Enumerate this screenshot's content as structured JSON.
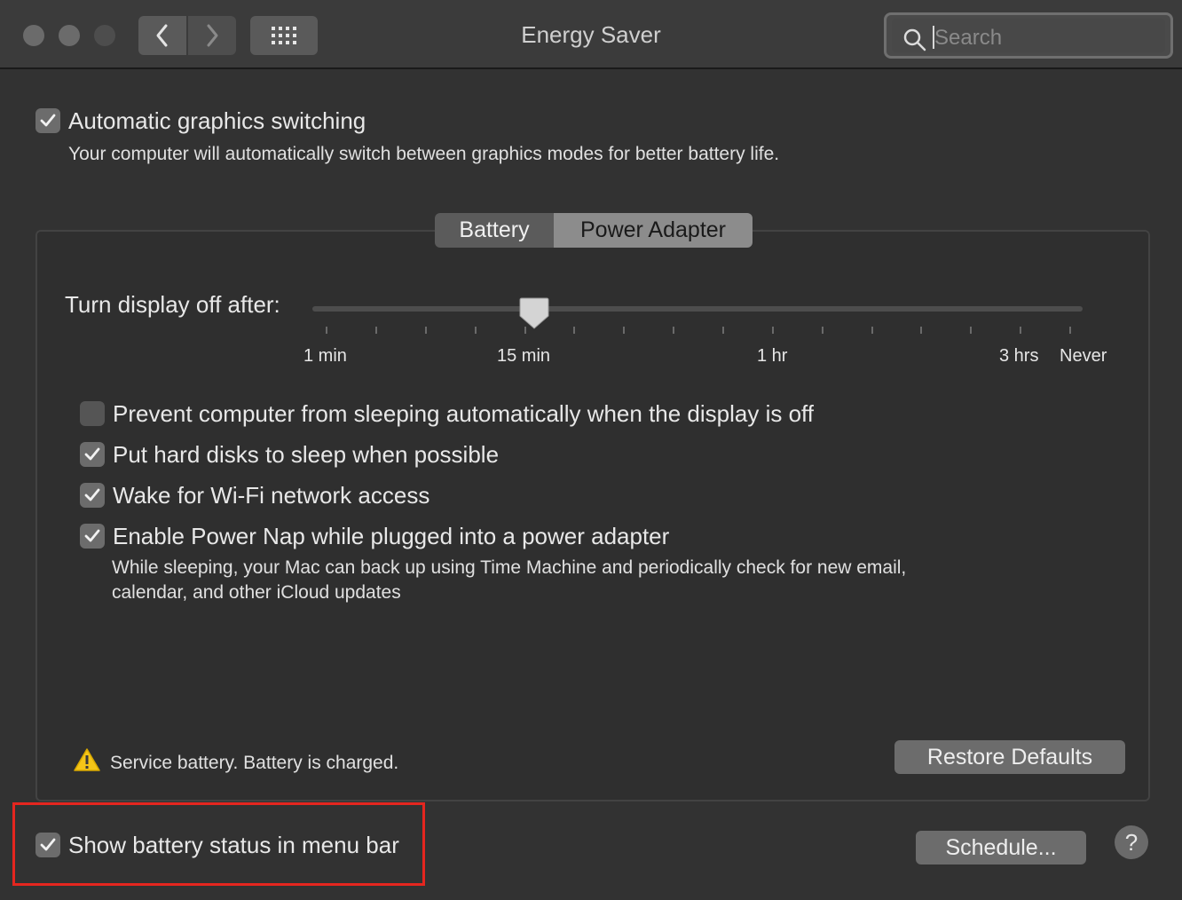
{
  "window": {
    "title": "Energy Saver"
  },
  "toolbar": {
    "back_icon": "chevron-left-icon",
    "forward_icon": "chevron-right-icon",
    "grid_icon": "grid-icon",
    "search_placeholder": "Search"
  },
  "graphics": {
    "checked": true,
    "label": "Automatic graphics switching",
    "description": "Your computer will automatically switch between graphics modes for better battery life."
  },
  "tabs": [
    {
      "label": "Battery",
      "selected": false
    },
    {
      "label": "Power Adapter",
      "selected": true
    }
  ],
  "display_off": {
    "label": "Turn display off after:",
    "tick_labels": [
      "1 min",
      "15 min",
      "1 hr",
      "3 hrs",
      "Never"
    ],
    "selected_value": "15 min"
  },
  "options": [
    {
      "checked": false,
      "label": "Prevent computer from sleeping automatically when the display is off"
    },
    {
      "checked": true,
      "label": "Put hard disks to sleep when possible"
    },
    {
      "checked": true,
      "label": "Wake for Wi-Fi network access"
    },
    {
      "checked": true,
      "label": "Enable Power Nap while plugged into a power adapter"
    }
  ],
  "power_nap_description_line1": "While sleeping, your Mac can back up using Time Machine and periodically check for new email,",
  "power_nap_description_line2": "calendar, and other iCloud updates",
  "warning": {
    "icon": "warning-icon",
    "text": "Service battery. Battery is charged."
  },
  "buttons": {
    "restore_defaults": "Restore Defaults",
    "schedule": "Schedule...",
    "help": "?"
  },
  "menu_bar_status": {
    "checked": true,
    "label": "Show battery status in menu bar"
  },
  "colors": {
    "highlight": "#e5261f",
    "warning": "#f5c518"
  }
}
